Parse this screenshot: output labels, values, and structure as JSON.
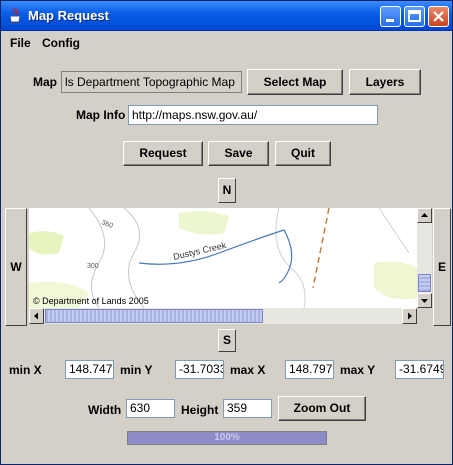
{
  "window": {
    "title": "Map Request",
    "icon": "java-cup-icon"
  },
  "menu": {
    "file": "File",
    "config": "Config"
  },
  "map_row": {
    "label": "Map",
    "value": "ls Department Topographic Map",
    "select_map": "Select Map",
    "layers": "Layers"
  },
  "info_row": {
    "label": "Map Info",
    "value": "http://maps.nsw.gov.au/"
  },
  "actions": {
    "request": "Request",
    "save": "Save",
    "quit": "Quit"
  },
  "nav": {
    "north": "N",
    "south": "S",
    "west": "W",
    "east": "E"
  },
  "map": {
    "copyright": "© Department of Lands 2005",
    "feature_label": "Dustys Creek",
    "contour_a": "360",
    "contour_b": "300"
  },
  "coords": {
    "min_x_label": "min X",
    "min_x": "148.747",
    "min_y_label": "min Y",
    "min_y": "-31.7033",
    "max_x_label": "max X",
    "max_x": "148.797",
    "max_y_label": "max Y",
    "max_y": "-31.6749"
  },
  "size": {
    "width_label": "Width",
    "width": "630",
    "height_label": "Height",
    "height": "359",
    "zoom_out": "Zoom Out"
  },
  "progress": {
    "percent": 100,
    "label": "100%"
  }
}
